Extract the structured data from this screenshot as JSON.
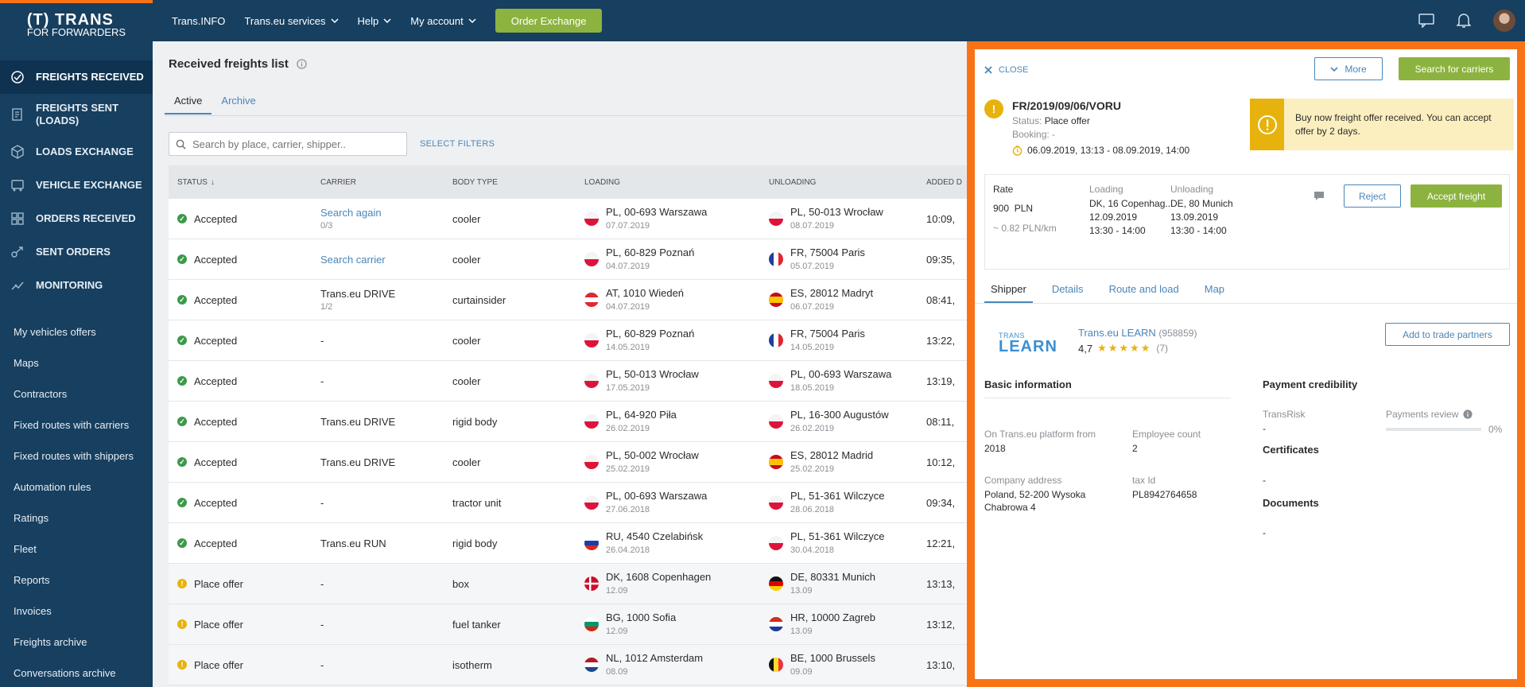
{
  "brand": {
    "logo": "(T) TRANS",
    "logo_sub": "FOR FORWARDERS",
    "accent": "#f97316"
  },
  "sidebar": {
    "main": [
      {
        "label": "FREIGHTS RECEIVED",
        "icon": "freights-received-icon",
        "active": true
      },
      {
        "label": "FREIGHTS SENT (LOADS)",
        "icon": "freights-sent-icon"
      },
      {
        "label": "LOADS EXCHANGE",
        "icon": "loads-exchange-icon"
      },
      {
        "label": "VEHICLE EXCHANGE",
        "icon": "vehicle-exchange-icon"
      },
      {
        "label": "ORDERS RECEIVED",
        "icon": "orders-received-icon"
      },
      {
        "label": "SENT ORDERS",
        "icon": "sent-orders-icon"
      },
      {
        "label": "MONITORING",
        "icon": "monitoring-icon"
      }
    ],
    "sub": [
      "My vehicles offers",
      "Maps",
      "Contractors",
      "Fixed routes with carriers",
      "Fixed routes with shippers",
      "Automation rules",
      "Ratings",
      "Fleet",
      "Reports",
      "Invoices",
      "Freights archive",
      "Conversations archive"
    ]
  },
  "topnav": {
    "links": [
      "Trans.INFO",
      "Trans.eu services",
      "Help",
      "My account"
    ],
    "order_button": "Order Exchange"
  },
  "page": {
    "title": "Received freights list",
    "tabs": [
      "Active",
      "Archive"
    ],
    "search_placeholder": "Search by place, carrier, shipper..",
    "filters": "SELECT FILTERS"
  },
  "table": {
    "headers": [
      "STATUS",
      "CARRIER",
      "BODY TYPE",
      "LOADING",
      "UNLOADING",
      "ADDED D"
    ],
    "rows": [
      {
        "status": "Accepted",
        "state": "ok",
        "carrier": "Search again",
        "carrier_link": true,
        "carrier_sub": "0/3",
        "body": "cooler",
        "load": "PL, 00-693 Warszawa",
        "load_date": "07.07.2019",
        "load_flag": "pl",
        "unload": "PL, 50-013 Wrocław",
        "unload_date": "08.07.2019",
        "unload_flag": "pl",
        "added": "10:09,"
      },
      {
        "status": "Accepted",
        "state": "ok",
        "carrier": "Search carrier",
        "carrier_link": true,
        "carrier_sub": "",
        "body": "cooler",
        "load": "PL, 60-829 Poznań",
        "load_date": "04.07.2019",
        "load_flag": "pl",
        "unload": "FR, 75004 Paris",
        "unload_date": "05.07.2019",
        "unload_flag": "fr",
        "added": "09:35,"
      },
      {
        "status": "Accepted",
        "state": "ok",
        "carrier": "Trans.eu DRIVE",
        "carrier_link": false,
        "carrier_sub": "1/2",
        "body": "curtainsider",
        "load": "AT, 1010 Wiedeń",
        "load_date": "04.07.2019",
        "load_flag": "at",
        "unload": "ES, 28012 Madryt",
        "unload_date": "06.07.2019",
        "unload_flag": "es",
        "added": "08:41,"
      },
      {
        "status": "Accepted",
        "state": "ok",
        "carrier": "-",
        "carrier_link": false,
        "carrier_sub": "",
        "body": "cooler",
        "load": "PL, 60-829 Poznań",
        "load_date": "14.05.2019",
        "load_flag": "pl",
        "unload": "FR, 75004 Paris",
        "unload_date": "14.05.2019",
        "unload_flag": "fr",
        "added": "13:22,"
      },
      {
        "status": "Accepted",
        "state": "ok",
        "carrier": "-",
        "carrier_link": false,
        "carrier_sub": "",
        "body": "cooler",
        "load": "PL, 50-013 Wrocław",
        "load_date": "17.05.2019",
        "load_flag": "pl",
        "unload": "PL, 00-693 Warszawa",
        "unload_date": "18.05.2019",
        "unload_flag": "pl",
        "added": "13:19,"
      },
      {
        "status": "Accepted",
        "state": "ok",
        "carrier": "Trans.eu DRIVE",
        "carrier_link": false,
        "carrier_sub": "",
        "body": "rigid body",
        "load": "PL, 64-920 Piła",
        "load_date": "26.02.2019",
        "load_flag": "pl",
        "unload": "PL, 16-300 Augustów",
        "unload_date": "26.02.2019",
        "unload_flag": "pl",
        "added": "08:11,"
      },
      {
        "status": "Accepted",
        "state": "ok",
        "carrier": "Trans.eu DRIVE",
        "carrier_link": false,
        "carrier_sub": "",
        "body": "cooler",
        "load": "PL, 50-002 Wrocław",
        "load_date": "25.02.2019",
        "load_flag": "pl",
        "unload": "ES, 28012 Madrid",
        "unload_date": "25.02.2019",
        "unload_flag": "es",
        "added": "10:12,"
      },
      {
        "status": "Accepted",
        "state": "ok",
        "carrier": "-",
        "carrier_link": false,
        "carrier_sub": "",
        "body": "tractor unit",
        "load": "PL, 00-693 Warszawa",
        "load_date": "27.06.2018",
        "load_flag": "pl",
        "unload": "PL, 51-361 Wilczyce",
        "unload_date": "28.06.2018",
        "unload_flag": "pl",
        "added": "09:34,"
      },
      {
        "status": "Accepted",
        "state": "ok",
        "carrier": "Trans.eu RUN",
        "carrier_link": false,
        "carrier_sub": "",
        "body": "rigid body",
        "load": "RU, 4540 Czelabińsk",
        "load_date": "26.04.2018",
        "load_flag": "ru",
        "unload": "PL, 51-361 Wilczyce",
        "unload_date": "30.04.2018",
        "unload_flag": "pl",
        "added": "12:21,"
      },
      {
        "status": "Place offer",
        "state": "warn",
        "carrier": "-",
        "carrier_link": false,
        "carrier_sub": "",
        "body": "box",
        "load": "DK, 1608 Copenhagen",
        "load_date": "12.09",
        "load_flag": "dk",
        "unload": "DE, 80331 Munich",
        "unload_date": "13.09",
        "unload_flag": "de",
        "added": "13:13,"
      },
      {
        "status": "Place offer",
        "state": "warn",
        "carrier": "-",
        "carrier_link": false,
        "carrier_sub": "",
        "body": "fuel tanker",
        "load": "BG, 1000 Sofia",
        "load_date": "12.09",
        "load_flag": "bg",
        "unload": "HR, 10000 Zagreb",
        "unload_date": "13.09",
        "unload_flag": "hr",
        "added": "13:12,"
      },
      {
        "status": "Place offer",
        "state": "warn",
        "carrier": "-",
        "carrier_link": false,
        "carrier_sub": "",
        "body": "isotherm",
        "load": "NL, 1012 Amsterdam",
        "load_date": "08.09",
        "load_flag": "nl",
        "unload": "BE, 1000 Brussels",
        "unload_date": "09.09",
        "unload_flag": "be",
        "added": "13:10,"
      }
    ]
  },
  "panel": {
    "close": "CLOSE",
    "more": "More",
    "search_carriers": "Search for carriers",
    "offer_id": "FR/2019/09/06/VORU",
    "status_label": "Status:",
    "status_value": "Place offer",
    "booking_label": "Booking:",
    "booking_value": "-",
    "dates": "06.09.2019, 13:13 - 08.09.2019, 14:00",
    "notice": "Buy now freight offer received. You can accept offer by 2 days.",
    "rate": {
      "label": "Rate",
      "amount": "900",
      "currency": "PLN",
      "per_km": "~ 0.82  PLN/km"
    },
    "loading": {
      "label": "Loading",
      "place": "DK, 16 Copenhag...",
      "date": "12.09.2019",
      "time": "13:30 - 14:00"
    },
    "unloading": {
      "label": "Unloading",
      "place": "DE, 80 Munich",
      "date": "13.09.2019",
      "time": "13:30 - 14:00"
    },
    "reject": "Reject",
    "accept": "Accept freight",
    "tabs": [
      "Shipper",
      "Details",
      "Route and load",
      "Map"
    ],
    "company": {
      "logo_small": "TRANS",
      "logo_big": "LEARN",
      "name": "Trans.eu LEARN",
      "id": "(958859)",
      "rating": "4,7",
      "stars": "★★★★★",
      "reviews": "(7)"
    },
    "add_partner": "Add to trade partners",
    "basic": {
      "title": "Basic information",
      "platform_label": "On Trans.eu platform from",
      "platform_value": "2018",
      "employees_label": "Employee count",
      "employees_value": "2",
      "address_label": "Company address",
      "address_line1": "Poland, 52-200 Wysoka",
      "address_line2": "Chabrowa 4",
      "tax_label": "tax Id",
      "tax_value": "PL8942764658"
    },
    "payment": {
      "title": "Payment credibility",
      "transrisk_label": "TransRisk",
      "transrisk_value": "-",
      "review_label": "Payments review",
      "review_value": "0%",
      "review_fraction": 0
    },
    "certificates": {
      "title": "Certificates",
      "value": "-"
    },
    "documents": {
      "title": "Documents",
      "value": "-"
    }
  }
}
